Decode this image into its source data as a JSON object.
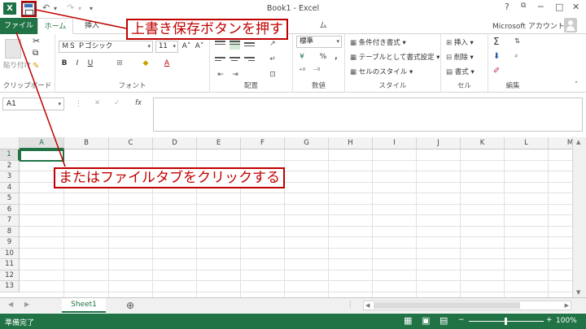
{
  "window": {
    "title": "Book1 - Excel",
    "help_glyph": "?",
    "restore_glyph": "⧉",
    "minimize_glyph": "─",
    "maximize_glyph": "□",
    "close_glyph": "✕"
  },
  "quick_access": {
    "app_logo": "X",
    "undo_glyph": "↶",
    "redo_glyph": "↷",
    "more_glyph": "▾"
  },
  "tabs": [
    {
      "label": "ファイル"
    },
    {
      "label": "ホーム"
    },
    {
      "label": "挿入"
    },
    {
      "label": "ム"
    }
  ],
  "account": {
    "label": "Microsoft アカウント"
  },
  "ribbon": {
    "clipboard": {
      "paste_label": "貼り付け",
      "group_label": "クリップボード"
    },
    "font": {
      "font_name": "ＭＳ Ｐゴシック",
      "font_size": "11",
      "grow": "A˄",
      "shrink": "A˅",
      "bold": "B",
      "italic": "I",
      "underline": "U",
      "group_label": "フォント"
    },
    "alignment": {
      "group_label": "配置"
    },
    "number": {
      "format": "標準",
      "percent": "%",
      "comma": ",",
      "group_label": "数値"
    },
    "styles": {
      "conditional": "条件付き書式",
      "table": "テーブルとして書式設定",
      "cell_styles": "セルのスタイル",
      "group_label": "スタイル"
    },
    "cells": {
      "insert": "挿入",
      "delete": "削除",
      "format": "書式",
      "group_label": "セル"
    },
    "editing": {
      "sum": "Σ",
      "group_label": "編集"
    }
  },
  "formula_bar": {
    "name_box": "A1",
    "cancel": "✕",
    "enter": "✓",
    "fx": "fx",
    "value": ""
  },
  "grid": {
    "columns": [
      "A",
      "B",
      "C",
      "D",
      "E",
      "F",
      "G",
      "H",
      "I",
      "J",
      "K",
      "L",
      "M"
    ],
    "rows": [
      "1",
      "2",
      "3",
      "4",
      "5",
      "6",
      "7",
      "8",
      "9",
      "10",
      "11",
      "12",
      "13"
    ],
    "active_cell": "A1"
  },
  "sheets": {
    "active": "Sheet1",
    "add_glyph": "⊕"
  },
  "status": {
    "ready": "準備完了",
    "zoom": "100%"
  },
  "annotations": {
    "save_callout": "上書き保存ボタンを押す",
    "file_callout": "またはファイルタブをクリックする"
  },
  "colors": {
    "accent": "#217346",
    "annotation": "#c00000"
  }
}
